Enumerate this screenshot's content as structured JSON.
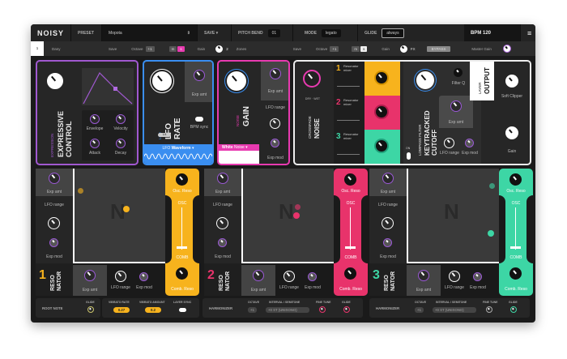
{
  "header": {
    "logo": "NOISY",
    "preset_label": "PRESET",
    "preset_value": "Mopota",
    "save": "SAVE",
    "pitch_bend_label": "PITCH BEND",
    "pitch_bend_value": "01",
    "mode_label": "MODE",
    "mode_value": "legato",
    "glide_label": "GLIDE",
    "glide_value": "always",
    "bpm": "BPM 120"
  },
  "layer1": {
    "num": "1",
    "name": "Dany",
    "save": "Save",
    "octave_label": "Octave",
    "octave_value": "+1",
    "btn_m": "m",
    "btn_s": "s",
    "gain": "Gain"
  },
  "layer2": {
    "num": "2",
    "name": "Zones",
    "save": "Save",
    "octave_label": "Octave",
    "octave_value": "+1",
    "btn_m": "m",
    "btn_s": "s",
    "gain": "Gain",
    "fx": "FX",
    "bypass": "BYPASS",
    "master_gain": "Master Gain"
  },
  "expression": {
    "sub": "EXPRESSION",
    "title1": "EXPRESSIVE",
    "title2": "CONTROL",
    "knobs": [
      "Envelope",
      "Velocity",
      "Attack",
      "Decay"
    ]
  },
  "lfo": {
    "sub": "LFO",
    "title1": "LFO",
    "title2": "RATE",
    "exp_amt": "Exp amt",
    "bpm_sync": "BPM sync",
    "waveform_prefix": "LFO",
    "waveform": "Waveform",
    "slider_val": "1/4"
  },
  "noise": {
    "sub": "NOISE",
    "title": "GAIN",
    "exp_amt": "Exp amt",
    "lfo_range": "LFO range",
    "exp_mod": "Exp mod",
    "type_bold": "White",
    "type": "Noise"
  },
  "crossfade": {
    "sub": "CROSSFADE",
    "title": "NOISE",
    "drywet": "DRY · WET"
  },
  "mixers": [
    {
      "num": "1",
      "label": "Resonator mixer"
    },
    {
      "num": "2",
      "label": "Resonator mixer"
    },
    {
      "num": "3",
      "label": "Resonator mixer"
    }
  ],
  "filter": {
    "sub": "LOWPASS FILTER",
    "title1": "KEYTRACKED",
    "title2": "CUTOFF",
    "filter_q": "Filter Q",
    "exp_amt": "Exp amt",
    "lfo_range": "LFO range",
    "exp_mod": "Exp mod",
    "on": "ON"
  },
  "output": {
    "sub": "LAYER",
    "title": "OUTPUT",
    "soft_clipper": "Soft Clipper",
    "gain": "Gain"
  },
  "resonators": [
    {
      "num": "1",
      "title1": "RESO",
      "title2": "NATOR",
      "exp_amt": "Exp amt",
      "lfo_range": "LFO range",
      "exp_mod": "Exp mod",
      "osc_reso": "Osc. Reso",
      "osc": "OSC",
      "comb": "COMB",
      "comb_reso": "Comb. Reso",
      "color": "#f7b31d"
    },
    {
      "num": "2",
      "title1": "RESO",
      "title2": "NATOR",
      "exp_amt": "Exp amt",
      "lfo_range": "LFO range",
      "exp_mod": "Exp mod",
      "osc_reso": "Osc. Reso",
      "osc": "OSC",
      "comb": "COMB",
      "comb_reso": "Comb. Reso",
      "color": "#e8336b"
    },
    {
      "num": "3",
      "title1": "RESO",
      "title2": "NATOR",
      "exp_amt": "Exp amt",
      "lfo_range": "LFO range",
      "exp_mod": "Exp mod",
      "osc_reso": "Osc. Reso",
      "osc": "OSC",
      "comb": "COMB",
      "comb_reso": "Comb. Reso",
      "color": "#3dd6a5"
    }
  ],
  "bottom": {
    "root_note": "ROOT NOTE",
    "glide": "GLIDE",
    "vibrato_rate": "VIBRATO RATE",
    "vibrato_rate_value": "0.27",
    "vibrato_amount": "VIBRATO AMOUNT",
    "vibrato_amount_value": "0.2",
    "layer_sync": "LAYER SYNC",
    "harm": [
      {
        "title": "HARMONIZER",
        "octave": "OCTAVE",
        "octave_value": "+1",
        "interval": "INTERVAL / SEMITONE",
        "interval_value": "+0 ST (UNISONO)",
        "fine_tune": "FINE TUNE",
        "glide": "GLIDE"
      },
      {
        "title": "HARMONIZER",
        "octave": "OCTAVE",
        "octave_value": "+1",
        "interval": "INTERVAL / SEMITONE",
        "interval_value": "+0 ST (UNISONO)",
        "fine_tune": "FINE TUNE",
        "glide": "GLIDE"
      }
    ]
  }
}
